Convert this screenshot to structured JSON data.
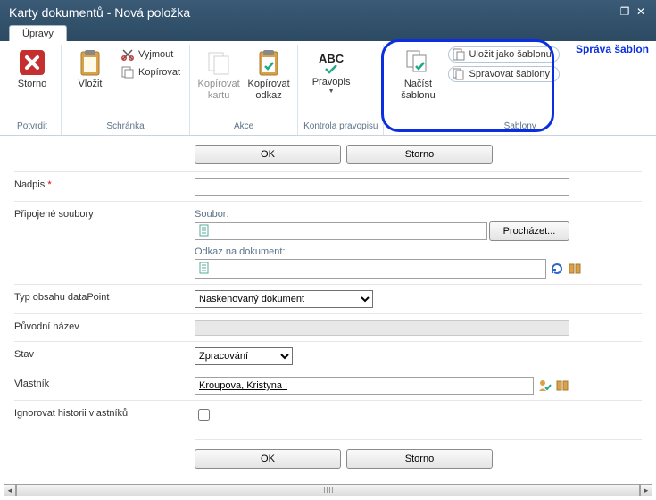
{
  "titlebar": {
    "title": "Karty dokumentů - Nová položka"
  },
  "tabs": {
    "active": "Úpravy"
  },
  "ribbon": {
    "groups": {
      "potvrdit": {
        "label": "Potvrdit",
        "storno": "Storno"
      },
      "schranka": {
        "label": "Schránka",
        "vlozit": "Vložit",
        "vyjmout": "Vyjmout",
        "kopirovat": "Kopírovat"
      },
      "akce": {
        "label": "Akce",
        "kopirovat_kartu": "Kopírovat\nkartu",
        "kopirovat_odkaz": "Kopírovat\nodkaz"
      },
      "pravopis": {
        "label": "Kontrola pravopisu",
        "pravopis": "Pravopis"
      },
      "sablony": {
        "label": "Šablony",
        "nacist": "Načíst\nšablonu",
        "ulozit": "Uložit jako šablonu",
        "spravovat": "Spravovat šablony"
      }
    },
    "annotation": "Správa šablon"
  },
  "buttons": {
    "ok": "OK",
    "storno": "Storno",
    "prochazet": "Procházet..."
  },
  "form": {
    "nadpis": {
      "label": "Nadpis",
      "value": ""
    },
    "pripojene": {
      "label": "Připojené soubory",
      "soubor_label": "Soubor:",
      "odkaz_label": "Odkaz na dokument:"
    },
    "typ": {
      "label": "Typ obsahu dataPoint",
      "value": "Naskenovaný dokument",
      "options": [
        "Naskenovaný dokument"
      ]
    },
    "puvodni": {
      "label": "Původní název"
    },
    "stav": {
      "label": "Stav",
      "value": "Zpracování",
      "options": [
        "Zpracování"
      ]
    },
    "vlastnik": {
      "label": "Vlastník",
      "value": "Kroupova, Kristyna ;"
    },
    "ignorovat": {
      "label": "Ignorovat historii vlastníků",
      "checked": false
    }
  },
  "icons": {
    "storno": "cancel-square",
    "vlozit": "clipboard",
    "vyjmout": "scissors",
    "kopirovat": "copy",
    "kopirovat_kartu": "copy-card",
    "kopirovat_odkaz": "clipboard-check",
    "pravopis": "abc-check",
    "nacist": "page-check",
    "ulozit": "page-save",
    "spravovat": "pages",
    "file": "file-green",
    "link": "file-link",
    "refresh": "refresh",
    "book": "book",
    "person_check": "person-check"
  },
  "colors": {
    "annotation": "#0b2fe0",
    "titlebar_bg": "#2c4a62",
    "required": "#c00"
  }
}
